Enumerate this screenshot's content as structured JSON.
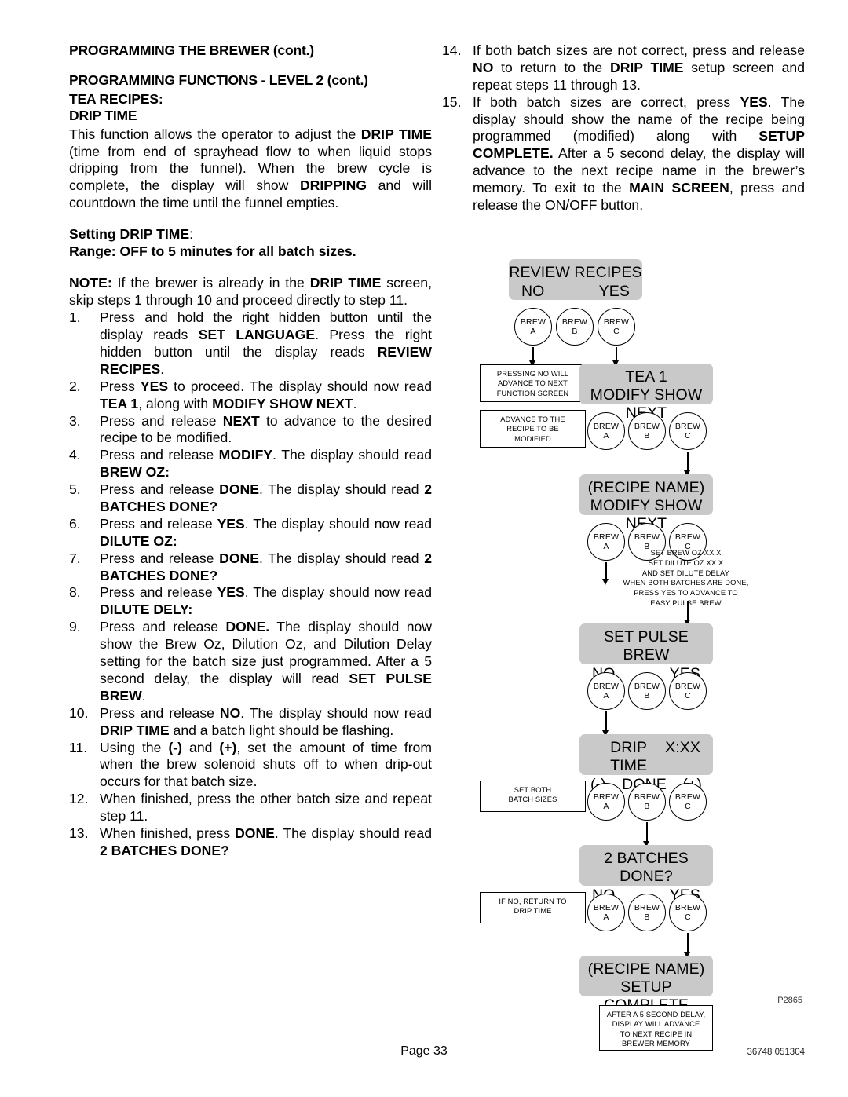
{
  "headings": {
    "main": "PROGRAMMING THE BREWER (cont.)",
    "sub": "PROGRAMMING FUNCTIONS - LEVEL  2 (cont.)",
    "group": "TEA RECIPES:",
    "function": "DRIP TIME"
  },
  "intro": {
    "p1_a": "This function allows the operator to adjust the ",
    "p1_b": "DRIP TIME",
    "p1_c": " (time from end of sprayhead flow to when liquid stops dripping from the funnel). When the brew cycle is complete, the display will show ",
    "p1_d": "DRIPPING",
    "p1_e": " and will countdown the time until the funnel empties."
  },
  "setting": {
    "label": "Setting ",
    "label_bold": "DRIP TIME",
    "label_colon": ":",
    "range": "Range: OFF to 5 minutes for all batch sizes."
  },
  "note": {
    "prefix": "NOTE:",
    "a": " If the brewer is already in the ",
    "b": "DRIP TIME",
    "c": " screen, skip steps 1 through 10 and proceed directly to step 11."
  },
  "steps": [
    {
      "num": "1.",
      "parts": [
        {
          "t": "Press and hold the right hidden button until the display reads ",
          "b": false
        },
        {
          "t": "SET LANGUAGE",
          "b": true
        },
        {
          "t": ". Press the right hidden button until the display reads ",
          "b": false
        },
        {
          "t": "REVIEW RECIPES",
          "b": true
        },
        {
          "t": ".",
          "b": false
        }
      ]
    },
    {
      "num": "2.",
      "parts": [
        {
          "t": "Press ",
          "b": false
        },
        {
          "t": "YES",
          "b": true
        },
        {
          "t": " to proceed.  The display should now read ",
          "b": false
        },
        {
          "t": "TEA 1",
          "b": true
        },
        {
          "t": ", along with ",
          "b": false
        },
        {
          "t": "MODIFY SHOW NEXT",
          "b": true
        },
        {
          "t": ".",
          "b": false
        }
      ]
    },
    {
      "num": "3.",
      "parts": [
        {
          "t": "Press and release ",
          "b": false
        },
        {
          "t": "NEXT",
          "b": true
        },
        {
          "t": " to advance to the desired recipe to be modified.",
          "b": false
        }
      ]
    },
    {
      "num": "4.",
      "parts": [
        {
          "t": "Press and release ",
          "b": false
        },
        {
          "t": "MODIFY",
          "b": true
        },
        {
          "t": ". The display should read ",
          "b": false
        },
        {
          "t": "BREW OZ:",
          "b": true
        }
      ]
    },
    {
      "num": "5.",
      "parts": [
        {
          "t": "Press and release ",
          "b": false
        },
        {
          "t": "DONE",
          "b": true
        },
        {
          "t": ".  The display should read ",
          "b": false
        },
        {
          "t": "2 BATCHES DONE?",
          "b": true
        }
      ]
    },
    {
      "num": "6.",
      "parts": [
        {
          "t": "Press and release ",
          "b": false
        },
        {
          "t": "YES",
          "b": true
        },
        {
          "t": ". The display should now read ",
          "b": false
        },
        {
          "t": "DILUTE OZ:",
          "b": true
        }
      ]
    },
    {
      "num": "7.",
      "parts": [
        {
          "t": "Press and release ",
          "b": false
        },
        {
          "t": "DONE",
          "b": true
        },
        {
          "t": ".  The display should read ",
          "b": false
        },
        {
          "t": "2 BATCHES DONE?",
          "b": true
        }
      ]
    },
    {
      "num": "8.",
      "parts": [
        {
          "t": "Press and release ",
          "b": false
        },
        {
          "t": "YES",
          "b": true
        },
        {
          "t": ". The display should now read ",
          "b": false
        },
        {
          "t": "DILUTE DELY:",
          "b": true
        }
      ]
    },
    {
      "num": "9.",
      "parts": [
        {
          "t": "Press and release ",
          "b": false
        },
        {
          "t": "DONE.",
          "b": true
        },
        {
          "t": " The display should now show the Brew Oz, Dilution Oz, and Dilution Delay setting for the batch size just programmed. After a 5 second delay, the display will read ",
          "b": false
        },
        {
          "t": "SET PULSE BREW",
          "b": true
        },
        {
          "t": ".",
          "b": false
        }
      ]
    },
    {
      "num": "10.",
      "parts": [
        {
          "t": "Press and release ",
          "b": false
        },
        {
          "t": "NO",
          "b": true
        },
        {
          "t": ". The display should now read ",
          "b": false
        },
        {
          "t": "DRIP TIME",
          "b": true
        },
        {
          "t": " and a batch light should be flashing.",
          "b": false
        }
      ]
    },
    {
      "num": "11.",
      "parts": [
        {
          "t": "Using the ",
          "b": false
        },
        {
          "t": "(-)",
          "b": true
        },
        {
          "t": " and ",
          "b": false
        },
        {
          "t": "(+)",
          "b": true
        },
        {
          "t": ", set the amount of time from when the brew solenoid shuts off to when drip-out occurs for that batch size.",
          "b": false
        }
      ]
    },
    {
      "num": "12.",
      "parts": [
        {
          "t": "When finished, press the other batch size and repeat step 11.",
          "b": false
        }
      ]
    },
    {
      "num": "13.",
      "parts": [
        {
          "t": "When finished, press ",
          "b": false
        },
        {
          "t": "DONE",
          "b": true
        },
        {
          "t": ". The display should read ",
          "b": false
        },
        {
          "t": "2 BATCHES DONE?",
          "b": true
        }
      ]
    },
    {
      "num": "14.",
      "parts": [
        {
          "t": "If both batch sizes are not correct, press and release ",
          "b": false
        },
        {
          "t": "NO",
          "b": true
        },
        {
          "t": " to return to the ",
          "b": false
        },
        {
          "t": "DRIP TIME",
          "b": true
        },
        {
          "t": " setup screen and repeat steps 11 through 13.",
          "b": false
        }
      ]
    },
    {
      "num": "15.",
      "parts": [
        {
          "t": "If both batch sizes are correct, press ",
          "b": false
        },
        {
          "t": "YES",
          "b": true
        },
        {
          "t": ". The display should show the name of the recipe being programmed (modified) along with ",
          "b": false
        },
        {
          "t": "SETUP COMPLETE.",
          "b": true
        },
        {
          "t": " After a 5 second delay, the display will advance to the next recipe name in the brewer’s memory. To exit to the ",
          "b": false
        },
        {
          "t": "MAIN SCREEN",
          "b": true
        },
        {
          "t": ", press and release the ON/OFF button.",
          "b": false
        }
      ]
    }
  ],
  "flowchart": {
    "displays": [
      {
        "id": "review-recipes",
        "line1": "REVIEW RECIPES",
        "left": "NO",
        "right": "YES"
      },
      {
        "id": "tea-1",
        "line1": "TEA 1",
        "line2": "MODIFY SHOW NEXT"
      },
      {
        "id": "recipe-name",
        "line1": "(RECIPE NAME)",
        "line2": "MODIFY SHOW NEXT"
      },
      {
        "id": "set-pulse-brew",
        "line1": "SET PULSE BREW",
        "left": "NO",
        "right": "YES"
      },
      {
        "id": "drip-time",
        "line1": "DRIP TIME",
        "line1b": "X:XX",
        "left": "(-)",
        "mid": "DONE",
        "right": "(+)"
      },
      {
        "id": "batches-done",
        "line1": "2 BATCHES DONE?",
        "left": "NO",
        "right": "YES"
      },
      {
        "id": "setup-complete",
        "line1": "(RECIPE NAME)",
        "line2": "SETUP COMPLETE"
      }
    ],
    "brew_buttons": {
      "a_top": "BREW",
      "a_bot": "A",
      "b_top": "BREW",
      "b_bot": "B",
      "c_top": "BREW",
      "c_bot": "C"
    },
    "notes": [
      {
        "id": "pressing-no",
        "lines": [
          "PRESSING NO WILL",
          "ADVANCE TO NEXT",
          "FUNCTION SCREEN"
        ]
      },
      {
        "id": "advance-recipe",
        "lines": [
          "ADVANCE TO THE",
          "RECIPE TO BE",
          "MODIFIED"
        ]
      },
      {
        "id": "set-both",
        "lines": [
          "SET BOTH",
          "BATCH SIZES"
        ]
      },
      {
        "id": "if-no-return",
        "lines": [
          "IF NO, RETURN TO",
          "DRIP TIME"
        ]
      },
      {
        "id": "after-delay",
        "lines": [
          "AFTER A 5 SECOND DELAY,",
          "DISPLAY WILL ADVANCE",
          "TO NEXT RECIPE IN",
          "BREWER MEMORY"
        ]
      }
    ],
    "free_note": {
      "id": "set-brew-oz-note",
      "lines": [
        "SET BREW OZ  XX.X",
        "SET DILUTE OZ  XX.X",
        "AND SET DILUTE DELAY",
        "WHEN BOTH BATCHES ARE DONE,",
        "PRESS YES TO ADVANCE TO",
        "EASY PULSE BREW"
      ]
    },
    "figure_code": "P2865"
  },
  "footer": {
    "page": "Page 33",
    "doc_code": "36748 051304"
  }
}
